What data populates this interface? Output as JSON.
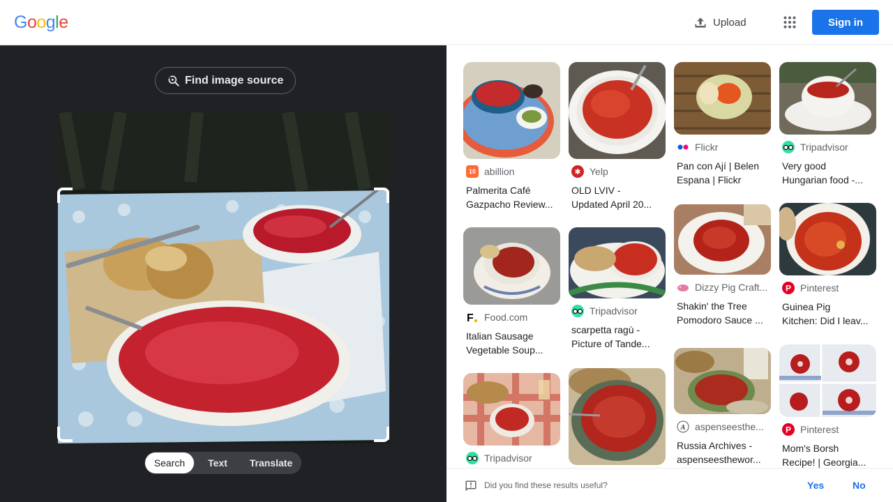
{
  "header": {
    "logo": [
      "G",
      "o",
      "o",
      "g",
      "l",
      "e"
    ],
    "logo_colors": [
      "#4285f4",
      "#ea4335",
      "#fbbc05",
      "#4285f4",
      "#34a853",
      "#ea4335"
    ],
    "upload_label": "Upload",
    "apps_icon": "apps-grid-icon",
    "signin_label": "Sign in"
  },
  "left_pane": {
    "find_source_label": "Find image source",
    "modes": [
      "Search",
      "Text",
      "Translate"
    ],
    "active_mode": "Search"
  },
  "results": [
    {
      "source": "abillion",
      "title1": "Palmerita Café",
      "title2": "Gazpacho Review...",
      "fav_color": "#ff6b35",
      "fav_text": "10"
    },
    {
      "source": "Yelp",
      "title1": "OLD LVIV -",
      "title2": "Updated April 20...",
      "fav_color": "#d32323",
      "fav_text": "✱"
    },
    {
      "source": "Flickr",
      "title1": "Pan con Ají | Belen",
      "title2": "Espana | Flickr",
      "fav_color": "#ffffff",
      "fav_text": "flickr"
    },
    {
      "source": "Tripadvisor",
      "title1": "Very good",
      "title2": "Hungarian food -...",
      "fav_color": "#34e0a1",
      "fav_text": "oo"
    },
    {
      "source": "Food.com",
      "title1": "Italian Sausage",
      "title2": "Vegetable Soup...",
      "fav_color": "#ffffff",
      "fav_text": "F."
    },
    {
      "source": "Tripadvisor",
      "title1": "scarpetta ragù -",
      "title2": "Picture of Tande...",
      "fav_color": "#34e0a1",
      "fav_text": "oo"
    },
    {
      "source": "Dizzy Pig Craft...",
      "title1": "Shakin' the Tree",
      "title2": "Pomodoro Sauce ...",
      "fav_color": "#ffffff",
      "fav_text": "pig"
    },
    {
      "source": "Pinterest",
      "title1": "Guinea Pig",
      "title2": "Kitchen: Did I leav...",
      "fav_color": "#e60023",
      "fav_text": "P"
    },
    {
      "source": "Tripadvisor",
      "title1": "",
      "title2": "",
      "fav_color": "#34e0a1",
      "fav_text": "oo"
    },
    {
      "source": "aspenseesthe...",
      "title1": "Russia Archives -",
      "title2": "aspenseesthewor...",
      "fav_color": "#ffffff",
      "fav_text": "A"
    },
    {
      "source": "Pinterest",
      "title1": "Mom's Borsh",
      "title2": "Recipe! | Georgia...",
      "fav_color": "#e60023",
      "fav_text": "P"
    }
  ],
  "feedback": {
    "question": "Did you find these results useful?",
    "yes": "Yes",
    "no": "No"
  }
}
